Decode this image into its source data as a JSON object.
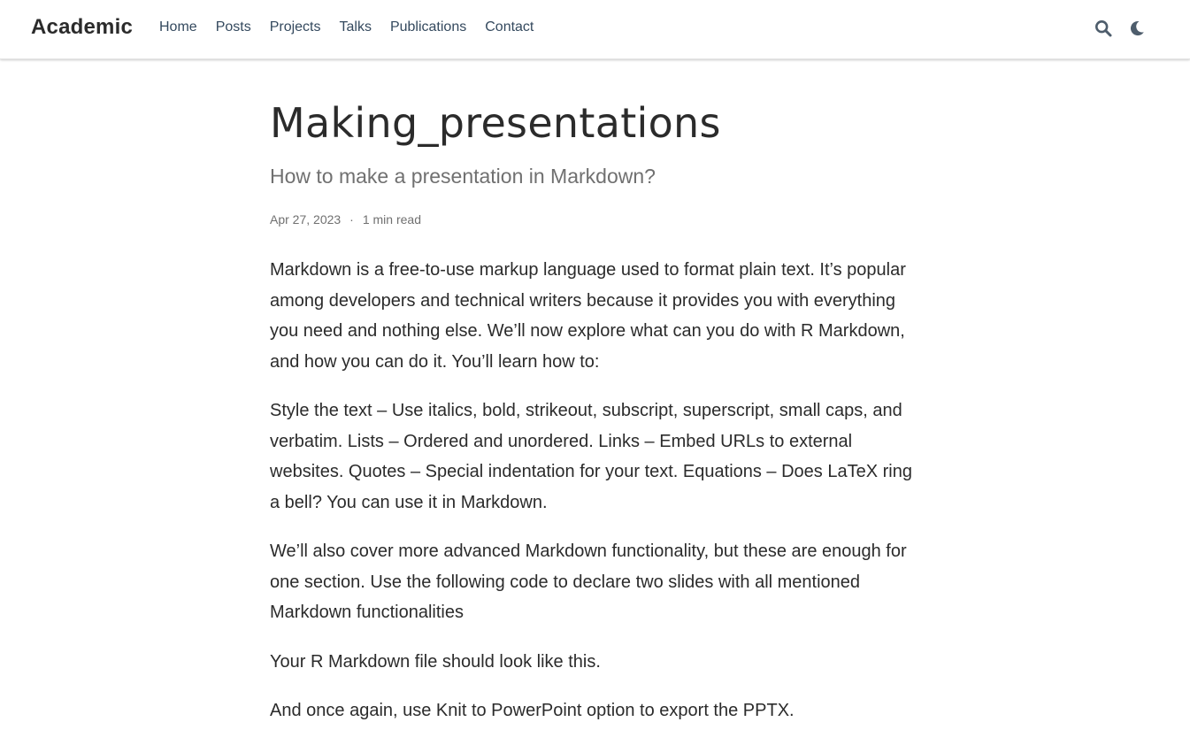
{
  "header": {
    "brand": "Academic",
    "nav": [
      "Home",
      "Posts",
      "Projects",
      "Talks",
      "Publications",
      "Contact"
    ],
    "icons": [
      "search-icon",
      "moon-icon"
    ]
  },
  "article": {
    "title": "Making_presentations",
    "subtitle": "How to make a presentation in Markdown?",
    "date": "Apr 27, 2023",
    "separator": "·",
    "read_time": "1 min read",
    "paragraphs": [
      "Markdown is a free-to-use markup language used to format plain text. It’s popular among developers and technical writers because it provides you with everything you need and nothing else. We’ll now explore what can you do with R Markdown, and how you can do it. You’ll learn how to:",
      "Style the text – Use italics, bold, strikeout, subscript, superscript, small caps, and verbatim. Lists – Ordered and unordered. Links – Embed URLs to external websites. Quotes – Special indentation for your text. Equations – Does LaTeX ring a bell? You can use it in Markdown.",
      "We’ll also cover more advanced Markdown functionality, but these are enough for one section. Use the following code to declare two slides with all mentioned Markdown functionalities",
      "Your R Markdown file should look like this.",
      "And once again, use Knit to PowerPoint option to export the PPTX."
    ]
  },
  "colors": {
    "text": "#2b2b2b",
    "nav_text": "#34495e",
    "muted": "#707070",
    "icon": "#4e5d6c"
  }
}
